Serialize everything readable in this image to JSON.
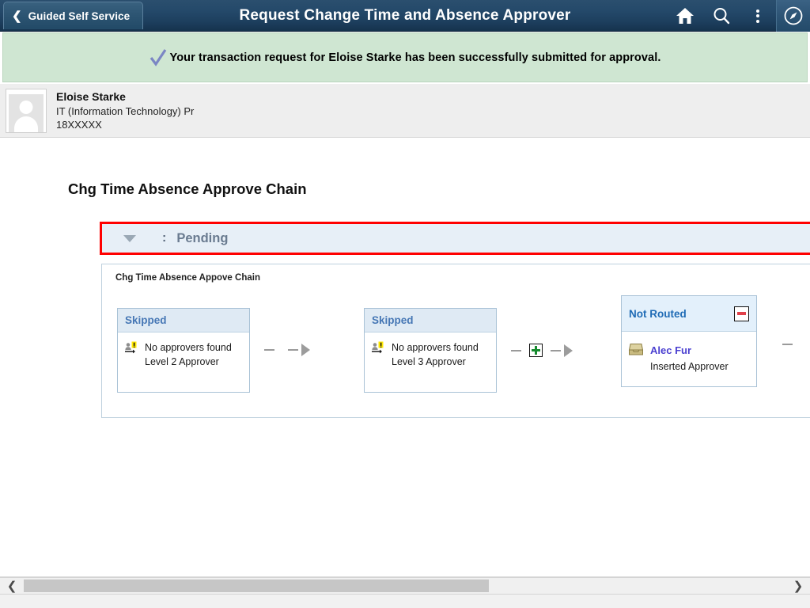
{
  "header": {
    "back_label": "Guided Self Service",
    "back_icon": "chevron-left-icon",
    "title": "Request Change Time and Absence Approver",
    "icons": [
      "home-icon",
      "search-icon",
      "actions-menu-icon",
      "navbar-compass-icon"
    ]
  },
  "banner": {
    "icon": "checkmark-icon",
    "message": "Your transaction request for Eloise Starke has been successfully submitted for approval."
  },
  "employee": {
    "avatar_icon": "person-avatar-icon",
    "name": "Eloise Starke",
    "department": "IT (Information Technology) Pr",
    "employee_id": "18XXXXX"
  },
  "page": {
    "title": "Chg Time Absence Approve Chain",
    "pending_section": {
      "caret_icon": "chevron-down-icon",
      "separator": ":",
      "status": "Pending"
    },
    "chain": {
      "subtitle": "Chg Time Absence Appove Chain",
      "stages": [
        {
          "status": "Skipped",
          "icon": "person-warning-icon",
          "line1": "No approvers found",
          "line2": "Level 2 Approver",
          "has_remove": false
        },
        {
          "status": "Skipped",
          "icon": "person-warning-icon",
          "line1": "No approvers found",
          "line2": "Level 3 Approver",
          "has_remove": false
        },
        {
          "status": "Not Routed",
          "icon": "inbox-tray-icon",
          "line1": "Alec Fur",
          "line2": "Inserted Approver",
          "has_remove": true,
          "remove_icon": "remove-minus-icon"
        }
      ],
      "connectors": [
        {
          "insert_icon": null,
          "arrow_icon": "arrow-right-icon"
        },
        {
          "insert_icon": "insert-plus-icon",
          "arrow_icon": "arrow-right-icon"
        },
        {
          "insert_icon": null,
          "arrow_icon": null
        }
      ]
    }
  },
  "footer": {
    "scroll_left_icon": "chevron-left-icon",
    "scroll_right_icon": "chevron-right-icon"
  },
  "colors": {
    "header_bg": "#24496a",
    "banner_bg": "#cfe6d2",
    "highlight_border": "#ff0000",
    "status_link": "#4a3fd0",
    "card_header_bg": "#dfeaf4",
    "pending_bg": "#e7eff7"
  }
}
